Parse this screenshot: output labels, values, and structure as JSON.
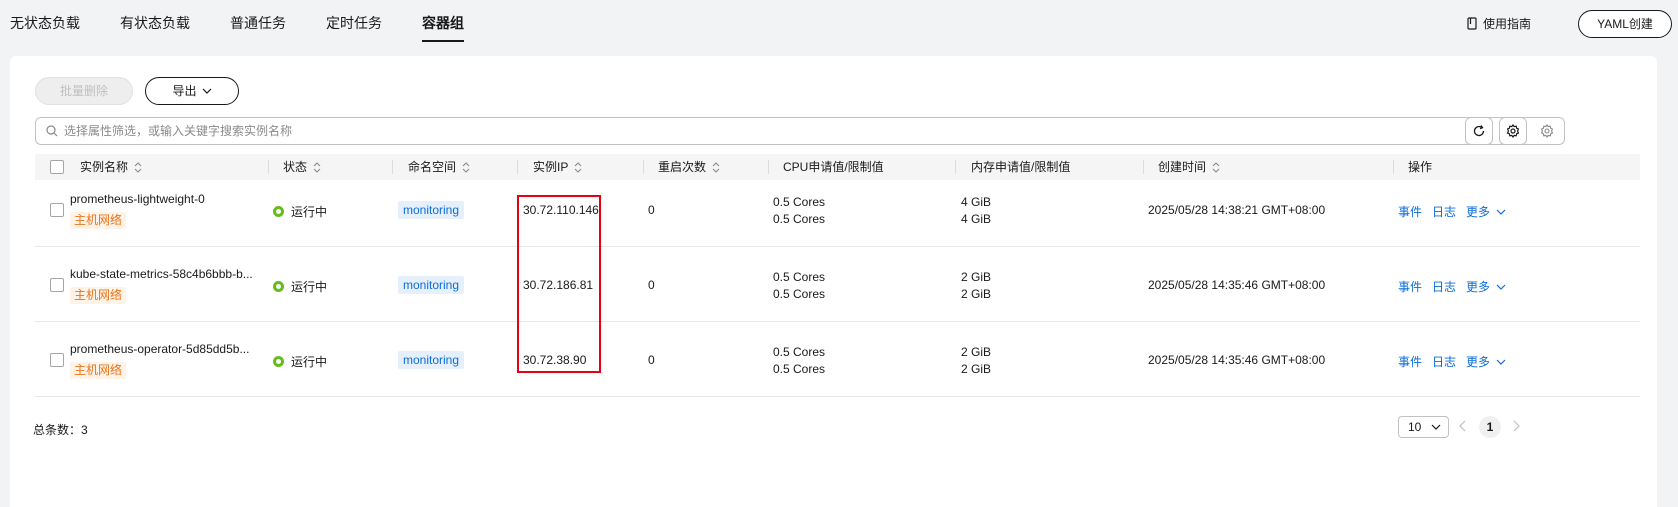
{
  "tabs": [
    {
      "label": "无状态负载",
      "active": false
    },
    {
      "label": "有状态负载",
      "active": false
    },
    {
      "label": "普通任务",
      "active": false
    },
    {
      "label": "定时任务",
      "active": false
    },
    {
      "label": "容器组",
      "active": true
    }
  ],
  "header": {
    "guide_label": "使用指南",
    "yaml_button": "YAML创建"
  },
  "toolbar": {
    "batch_delete": "批量删除",
    "export": "导出"
  },
  "search": {
    "placeholder": "选择属性筛选，或输入关键字搜索实例名称"
  },
  "columns": [
    "实例名称",
    "状态",
    "命名空间",
    "实例IP",
    "重启次数",
    "CPU申请值/限制值",
    "内存申请值/限制值",
    "创建时间",
    "操作"
  ],
  "rows": [
    {
      "name": "prometheus-lightweight-0",
      "tag": "主机网络",
      "status": "运行中",
      "namespace": "monitoring",
      "ip": "30.72.110.146",
      "restarts": "0",
      "cpu_request": "0.5 Cores",
      "cpu_limit": "0.5 Cores",
      "mem_request": "4 GiB",
      "mem_limit": "4 GiB",
      "created": "2025/05/28 14:38:21 GMT+08:00"
    },
    {
      "name": "kube-state-metrics-58c4b6bbb-b...",
      "tag": "主机网络",
      "status": "运行中",
      "namespace": "monitoring",
      "ip": "30.72.186.81",
      "restarts": "0",
      "cpu_request": "0.5 Cores",
      "cpu_limit": "0.5 Cores",
      "mem_request": "2 GiB",
      "mem_limit": "2 GiB",
      "created": "2025/05/28 14:35:46 GMT+08:00"
    },
    {
      "name": "prometheus-operator-5d85dd5b...",
      "tag": "主机网络",
      "status": "运行中",
      "namespace": "monitoring",
      "ip": "30.72.38.90",
      "restarts": "0",
      "cpu_request": "0.5 Cores",
      "cpu_limit": "0.5 Cores",
      "mem_request": "2 GiB",
      "mem_limit": "2 GiB",
      "created": "2025/05/28 14:35:46 GMT+08:00"
    }
  ],
  "row_actions": {
    "events": "事件",
    "logs": "日志",
    "more": "更多"
  },
  "footer": {
    "total": "总条数：3",
    "page_size": "10",
    "current_page": "1"
  },
  "colors": {
    "running_status": "#66bb1d",
    "link": "#0b6dd9",
    "host_network_tag": "#e8741a",
    "highlight_box": "#e60012"
  }
}
